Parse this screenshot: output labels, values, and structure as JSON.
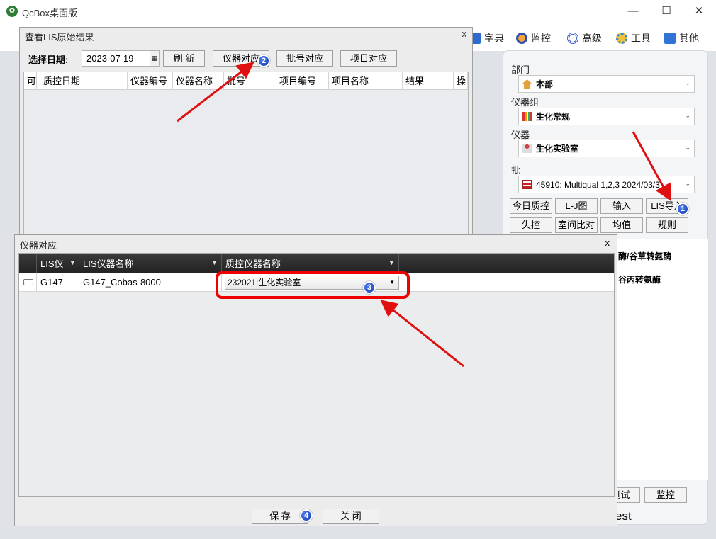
{
  "window": {
    "title": "QcBox桌面版",
    "logo_glyph": "✿",
    "minimize": "—",
    "maximize": "☐",
    "close": "✕"
  },
  "menu": [
    {
      "label": "字典",
      "icon": "book-icon",
      "color": "#2d6ad1"
    },
    {
      "label": "监控",
      "icon": "monitor-icon",
      "color": "#2d4fb3"
    },
    {
      "label": "高级",
      "icon": "target-icon",
      "color": "#3a5cc8"
    },
    {
      "label": "工具",
      "icon": "gear-icon",
      "color": "#2f8fd0"
    },
    {
      "label": "其他",
      "icon": "info-icon",
      "color": "#3273d6"
    }
  ],
  "right_panel": {
    "dept_label": "部门",
    "dept_value": "本部",
    "group_label": "仪器组",
    "group_value": "生化常规",
    "instrument_label": "仪器",
    "instrument_value": "生化实验室",
    "batch_label": "批",
    "batch_value": "45910:  Multiqual 1,2,3  2024/03/3",
    "buttons": [
      "今日质控",
      "L-J图",
      "输入",
      "LIS导入",
      "失控",
      "室间比对",
      "均值",
      "规则"
    ],
    "text_1": "酶/谷草转氨酶",
    "text_2": "谷丙转氨酶",
    "btn_test": "测试",
    "btn_monitor": "监控",
    "text_test": "est"
  },
  "lis_dialog": {
    "title": "查看LIS原始结果",
    "close": "x",
    "date_label": "选择日期:",
    "date_value": "2023-07-19",
    "date_btn": "▦",
    "buttons": [
      "刷 新",
      "仪器对应",
      "批号对应",
      "项目对应"
    ],
    "columns": [
      "可",
      "质控日期",
      "仪器编号",
      "仪器名称",
      "批号",
      "项目编号",
      "项目名称",
      "结果",
      "操"
    ]
  },
  "map_dialog": {
    "title": "仪器对应",
    "close": "x",
    "columns": [
      "LIS仪",
      "LIS仪器名称",
      "质控仪器名称"
    ],
    "row": {
      "lis_code": "G147",
      "lis_name": "G147_Cobas-8000",
      "qc_instrument": "232021:生化实验室"
    },
    "save": "保 存",
    "close_btn": "关 闭"
  },
  "annotations": [
    "1",
    "2",
    "3",
    "4"
  ],
  "colors": {
    "accent_red": "#ee0000",
    "badge_blue": "#1f4fd8"
  }
}
